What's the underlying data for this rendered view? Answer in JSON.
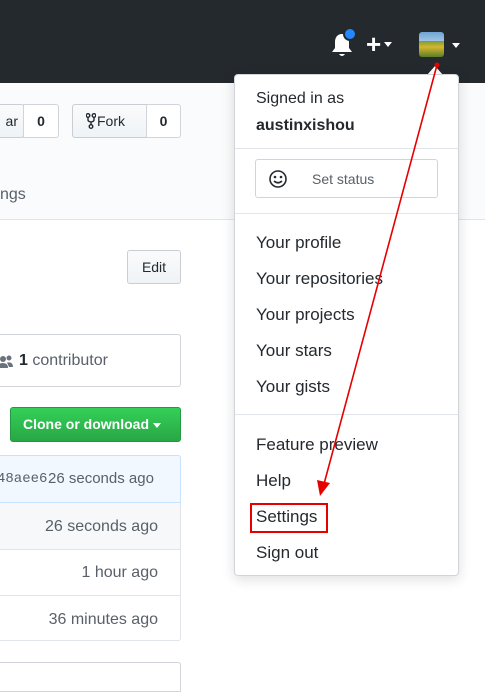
{
  "header": {
    "notification_icon": "bell-icon",
    "create_icon": "plus-icon",
    "avatar_icon": "avatar-icon"
  },
  "repo": {
    "star_fragment": "ar",
    "star_count": "0",
    "fork_label": "Fork",
    "fork_count": "0",
    "tab_fragment": "ngs",
    "edit_label": "Edit",
    "contributors_count": "1",
    "contributors_label": "contributor",
    "clone_label": "Clone or download",
    "commit_hash_fragment": "48aee6",
    "commit_time": "26 seconds ago",
    "file_rows": [
      "26 seconds ago",
      "1 hour ago",
      "36 minutes ago"
    ]
  },
  "dropdown": {
    "signed_in_as": "Signed in as",
    "username": "austinxishou",
    "set_status": "Set status",
    "items_group1": [
      "Your profile",
      "Your repositories",
      "Your projects",
      "Your stars",
      "Your gists"
    ],
    "items_group2": [
      "Feature preview",
      "Help",
      "Settings",
      "Sign out"
    ]
  },
  "annotation": {
    "highlight_color": "#e60000",
    "arrow_color": "#e60000"
  }
}
